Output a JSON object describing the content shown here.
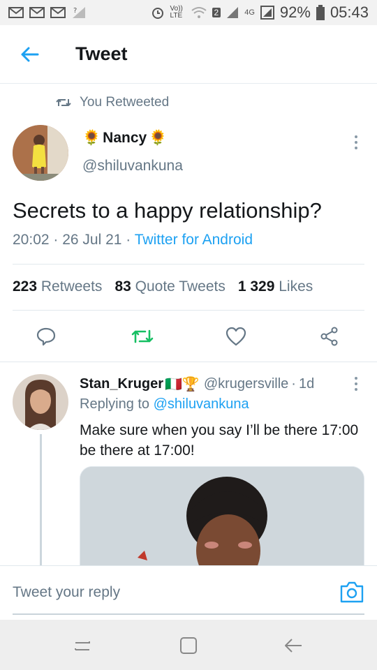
{
  "statusbar": {
    "battery": "92%",
    "time": "05:43",
    "signal_4g": "4G",
    "volte": "Vo)) LTE",
    "sim_badge": "2"
  },
  "header": {
    "title": "Tweet"
  },
  "tweet": {
    "retweet_label": "You Retweeted",
    "author_name": "Nancy",
    "author_emoji": "🌻",
    "author_handle": "@shiluvankuna",
    "text": "Secrets to a happy relationship?",
    "time": "20:02",
    "date": "26 Jul 21",
    "source": "Twitter for Android",
    "retweets_count": "223",
    "retweets_label": "Retweets",
    "quotes_count": "83",
    "quotes_label": "Quote Tweets",
    "likes_count": "1 329",
    "likes_label": "Likes"
  },
  "reply": {
    "name": "Stan_Kruger",
    "badges": "🇮🇹🏆",
    "handle": "@krugersville",
    "age": "1d",
    "replying_label": "Replying to",
    "replying_handle": "@shiluvankuna",
    "text": "Make sure when you say I’ll be there 17:00 be there at 17:00!"
  },
  "compose": {
    "placeholder": "Tweet your reply"
  },
  "colors": {
    "accent": "#1da1f2",
    "retweet_active": "#17bf63",
    "muted": "#657786"
  }
}
